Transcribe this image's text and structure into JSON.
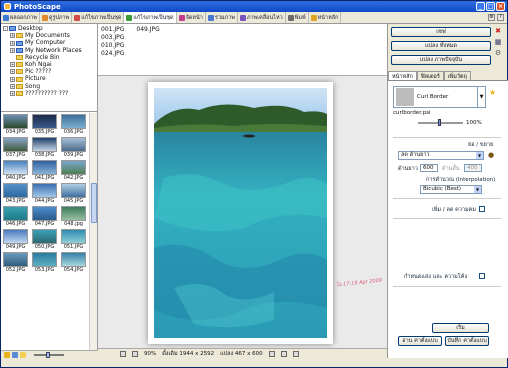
{
  "window": {
    "title": "PhotoScape"
  },
  "tabs": [
    {
      "label": "ผลออกภาพ",
      "color": "#3d7ad6",
      "active": false
    },
    {
      "label": "ดูรูปภาพ",
      "color": "#e08a2c",
      "active": false
    },
    {
      "label": "แก้ไขภาพเป็นชุด",
      "color": "#d24b4b",
      "active": false
    },
    {
      "label": "แก้ไขภาพเป็นชุด",
      "color": "#3a9a3a",
      "active": true
    },
    {
      "label": "จัดหน้า",
      "color": "#c43c8c",
      "active": false
    },
    {
      "label": "รวมภาพ",
      "color": "#4a7ad0",
      "active": false
    },
    {
      "label": "ภาพเคลื่อนไหว",
      "color": "#7a52c0",
      "active": false
    },
    {
      "label": "พิมพ์",
      "color": "#6b6b6b",
      "active": false
    },
    {
      "label": "หน้าหลัก",
      "color": "#e0a020",
      "active": false
    }
  ],
  "tree": [
    {
      "label": "Desktop",
      "expander": "-",
      "blue": true
    },
    {
      "label": "My Documents",
      "expander": "+",
      "blue": false
    },
    {
      "label": "My Computer",
      "expander": "+",
      "blue": true
    },
    {
      "label": "My Network Places",
      "expander": "+",
      "blue": true
    },
    {
      "label": "Recycle Bin",
      "expander": "",
      "blue": false
    },
    {
      "label": "Koh Ngai",
      "expander": "+",
      "blue": false
    },
    {
      "label": "Pic ?????",
      "expander": "+",
      "blue": false
    },
    {
      "label": "Picture",
      "expander": "+",
      "blue": false
    },
    {
      "label": "Song",
      "expander": "+",
      "blue": false
    },
    {
      "label": "?????????? ???",
      "expander": "+",
      "blue": false
    }
  ],
  "thumbnails": [
    {
      "caption": "034.JPG",
      "c1": "#6b8fb5",
      "c2": "#2c4a2a"
    },
    {
      "caption": "035.JPG",
      "c1": "#1d2a4a",
      "c2": "#3b5a8a"
    },
    {
      "caption": "036.JPG",
      "c1": "#3e6e9a",
      "c2": "#7bb0d0"
    },
    {
      "caption": "037.JPG",
      "c1": "#8aa6c8",
      "c2": "#3d5b3a"
    },
    {
      "caption": "038.JPG",
      "c1": "#1f3f6a",
      "c2": "#c8d8e8"
    },
    {
      "caption": "039.JPG",
      "c1": "#a8c0d8",
      "c2": "#4a6a8a"
    },
    {
      "caption": "040.JPG",
      "c1": "#4a80c0",
      "c2": "#d0e4f4"
    },
    {
      "caption": "041.JPG",
      "c1": "#2f5f9f",
      "c2": "#89b4d8"
    },
    {
      "caption": "042.JPG",
      "c1": "#7aa8d0",
      "c2": "#4f7f4f"
    },
    {
      "caption": "043.JPG",
      "c1": "#5a90c8",
      "c2": "#2a6aa0"
    },
    {
      "caption": "044.JPG",
      "c1": "#3a6fb0",
      "c2": "#a0c8e8"
    },
    {
      "caption": "045.JPG",
      "c1": "#b0cde4",
      "c2": "#3f6f9f"
    },
    {
      "caption": "046.JPG",
      "c1": "#3ca0b0",
      "c2": "#1e7a8a"
    },
    {
      "caption": "047.JPG",
      "c1": "#4c8fd0",
      "c2": "#2a5a8a"
    },
    {
      "caption": "048.jpg",
      "c1": "#3b7a5a",
      "c2": "#98c0a0"
    },
    {
      "caption": "049.JPG",
      "c1": "#4a7ac0",
      "c2": "#c0d8f0"
    },
    {
      "caption": "050.JPG",
      "c1": "#3aa0b8",
      "c2": "#2c6a70"
    },
    {
      "caption": "051.JPG",
      "c1": "#2f8ab0",
      "c2": "#8fd0d8"
    },
    {
      "caption": "052.JPG",
      "c1": "#6a9abd",
      "c2": "#2e5f7f"
    },
    {
      "caption": "053.JPG",
      "c1": "#2a7aa0",
      "c2": "#5cb0c0"
    },
    {
      "caption": "054.JPG",
      "c1": "#3680a8",
      "c2": "#a8d8e0"
    }
  ],
  "files": [
    [
      "001.JPG",
      "003.JPG",
      "010.JPG",
      "024.JPG"
    ],
    [
      "049.JPG"
    ]
  ],
  "status": {
    "zoom": "90%",
    "original_size": "ดั้งเดิม 1944 x 2592",
    "converted_size": "แปลง 467 x 600"
  },
  "watermark": "ไอ 17-19 Apr 2009",
  "right": {
    "save": "เซฟ",
    "convert_all": "แปลง ทั้งหมด",
    "convert_current": "แปลง ภาพปัจจุบัน",
    "tabs": [
      "หน้าหลัก",
      "ฟิลเตอร์",
      "เพิ่มวัตถุ"
    ],
    "frame_name": "Curl Border",
    "frame_file": "curlborder.psi",
    "frame_opacity": "100%",
    "resize_section": "ย่อ / ขยาย",
    "resize_mode": "ลด ด้านยาว",
    "long_side_label": "ด้านยาว",
    "long_side_value": "600",
    "short_side_label": "ด้านสั้น",
    "short_side_value": "400",
    "interp_label": "การคำนวณ (Interpolation)",
    "interp_value": "Bicubic (Best)",
    "sharpen_label": "เพิ่ม / ลด ความคม",
    "brightness_label": "กำหนดแสง และ ความโค้ง",
    "ok": "เริ่ม",
    "load_settings": "อ่าน ค่าตั้งแบบ",
    "save_settings": "บันทึก ค่าตั้งแบบ"
  }
}
